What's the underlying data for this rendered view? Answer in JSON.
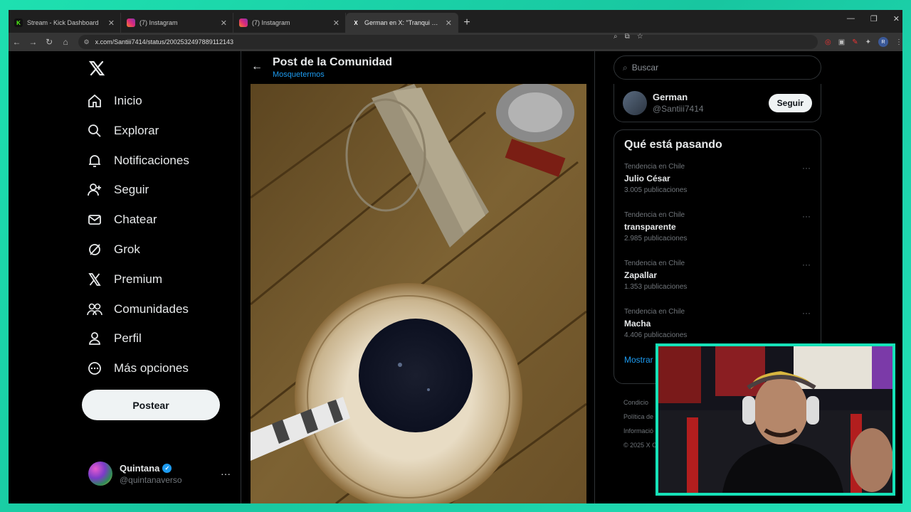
{
  "browser": {
    "tabs": [
      {
        "title": "Stream - Kick Dashboard",
        "fav": "K",
        "fav_color": "#53fc18",
        "active": false
      },
      {
        "title": "(7) Instagram",
        "fav": "",
        "fav_color": "#d6249f",
        "active": false
      },
      {
        "title": "(7) Instagram",
        "fav": "",
        "fav_color": "#d6249f",
        "active": false
      },
      {
        "title": "German en X: \"Tranqui Quintana",
        "fav": "X",
        "fav_color": "#000000",
        "active": true
      }
    ],
    "url": "x.com/Santiii7414/status/2002532497889112143",
    "profile_initial": "R"
  },
  "sidebar": {
    "nav": [
      {
        "label": "Inicio",
        "icon": "home-icon"
      },
      {
        "label": "Explorar",
        "icon": "search-icon"
      },
      {
        "label": "Notificaciones",
        "icon": "bell-icon"
      },
      {
        "label": "Seguir",
        "icon": "follow-icon"
      },
      {
        "label": "Chatear",
        "icon": "mail-icon"
      },
      {
        "label": "Grok",
        "icon": "grok-icon"
      },
      {
        "label": "Premium",
        "icon": "x-logo-icon"
      },
      {
        "label": "Comunidades",
        "icon": "communities-icon"
      },
      {
        "label": "Perfil",
        "icon": "person-icon"
      },
      {
        "label": "Más opciones",
        "icon": "more-circle-icon"
      }
    ],
    "post_button": "Postear",
    "account": {
      "name": "Quintana",
      "handle": "@quintanaverso"
    }
  },
  "main": {
    "title": "Post de la Comunidad",
    "community": "Mosquetermos"
  },
  "right": {
    "search_placeholder": "Buscar",
    "follow_suggestion": {
      "name": "German",
      "handle": "@Santiii7414",
      "button": "Seguir"
    },
    "trends_title": "Qué está pasando",
    "trends": [
      {
        "context": "Tendencia en Chile",
        "name": "Julio César",
        "count": "3.005 publicaciones"
      },
      {
        "context": "Tendencia en Chile",
        "name": "transparente",
        "count": "2.985 publicaciones"
      },
      {
        "context": "Tendencia en Chile",
        "name": "Zapallar",
        "count": "1.353 publicaciones"
      },
      {
        "context": "Tendencia en Chile",
        "name": "Macha",
        "count": "4.406 publicaciones"
      }
    ],
    "show_more": "Mostrar",
    "footer": [
      "Condicio",
      "Política de",
      "Informació",
      "© 2025 X C"
    ]
  },
  "colors": {
    "accent": "#1d9bf0",
    "frame": "#1fd6a8"
  }
}
